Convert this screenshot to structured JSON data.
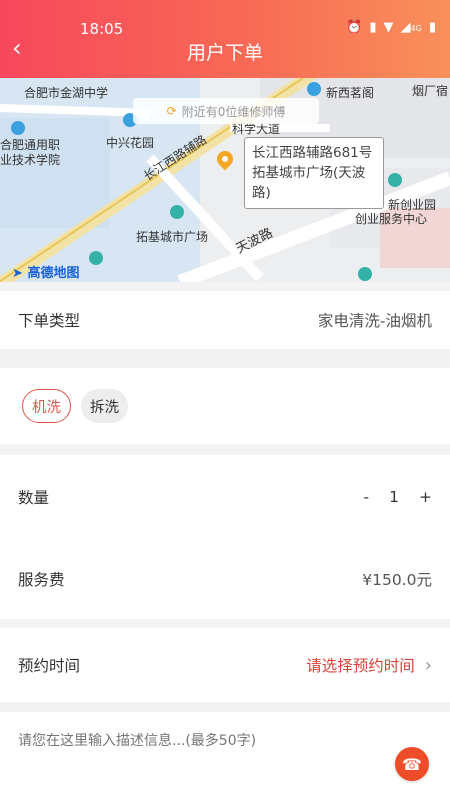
{
  "status_bar": {
    "time": "18:05",
    "icons": [
      "alarm-icon",
      "vibrate-icon",
      "wifi-icon",
      "signal-icon",
      "battery-icon"
    ],
    "network_label": "4G"
  },
  "header": {
    "title": "用户下单",
    "back_icon": "chevron-left-icon"
  },
  "map": {
    "nearby_text": "附近有0位维修师傅",
    "address_popup": "长江西路辅路681号拓基城市广场(天波路)",
    "logo_text": "高德地图",
    "labels": {
      "school1": "合肥市金湖中学",
      "xinxi": "新西茗阁",
      "yanchang": "烟厂宿",
      "tech_road": "科学大道",
      "college": "合肥通用职业技术学院",
      "zhongxing": "中兴花园",
      "changjiang_road": "长江西路辅路",
      "xinchuangye": "新创业园",
      "chuangye_center": "创业服务中心",
      "tuoji": "拓基城市广场",
      "tianbo": "天波路"
    }
  },
  "order_type": {
    "label": "下单类型",
    "value": "家电清洗-油烟机"
  },
  "wash_options": {
    "options": [
      {
        "label": "机洗",
        "selected": true
      },
      {
        "label": "拆洗",
        "selected": false
      }
    ]
  },
  "quantity": {
    "label": "数量",
    "minus": "-",
    "value": "1",
    "plus": "+"
  },
  "service_fee": {
    "label": "服务费",
    "value": "¥150.0元"
  },
  "appointment": {
    "label": "预约时间",
    "value": "请选择预约时间"
  },
  "description": {
    "placeholder": "请您在这里输入描述信息...(最多50字)"
  },
  "colors": {
    "header_start": "#f7485c",
    "header_end": "#f9905a",
    "accent_red": "#e0564d",
    "fab": "#ef4d2a"
  }
}
